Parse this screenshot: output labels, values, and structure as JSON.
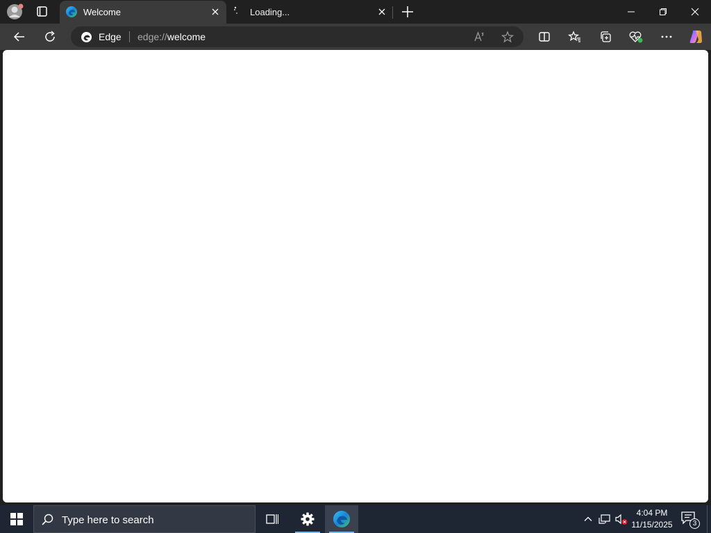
{
  "browser": {
    "tabs": [
      {
        "title": "Welcome",
        "favicon": "edge-icon",
        "active": true
      },
      {
        "title": "Loading...",
        "favicon": "loading-spinner-icon",
        "active": false
      }
    ],
    "address_bar": {
      "identity_label": "Edge",
      "url_scheme": "edge://",
      "url_host": "welcome"
    },
    "toolbar_icons": [
      "back-icon",
      "refresh-icon",
      "read-aloud-icon",
      "favorite-star-icon",
      "split-screen-icon",
      "favorites-icon",
      "collections-icon",
      "browser-essentials-icon",
      "more-icon",
      "copilot-icon"
    ],
    "window_controls": [
      "minimize-icon",
      "restore-icon",
      "close-icon"
    ]
  },
  "taskbar": {
    "search_placeholder": "Type here to search",
    "apps": [
      "task-view-icon",
      "settings-icon",
      "edge-icon"
    ],
    "tray_icons": [
      "chevron-up-icon",
      "network-icon",
      "volume-muted-icon"
    ],
    "time": "4:04 PM",
    "date": "11/15/2025",
    "notification_count": "3"
  },
  "colors": {
    "titlebar": "#202020",
    "toolbar": "#3b3b3b",
    "taskbar": "#1e2533",
    "accent": "#76b9ed"
  }
}
